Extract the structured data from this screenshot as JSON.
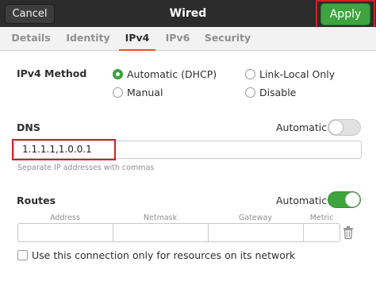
{
  "header": {
    "cancel_label": "Cancel",
    "title": "Wired",
    "apply_label": "Apply"
  },
  "tabs": [
    {
      "label": "Details"
    },
    {
      "label": "Identity"
    },
    {
      "label": "IPv4",
      "active": true
    },
    {
      "label": "IPv6"
    },
    {
      "label": "Security"
    }
  ],
  "ipv4_method": {
    "label": "IPv4 Method",
    "options": [
      {
        "label": "Automatic (DHCP)",
        "selected": true
      },
      {
        "label": "Link-Local Only",
        "selected": false
      },
      {
        "label": "Manual",
        "selected": false
      },
      {
        "label": "Disable",
        "selected": false
      }
    ]
  },
  "dns": {
    "label": "DNS",
    "automatic_label": "Automatic",
    "automatic_on": false,
    "value": "1.1.1.1,1.0.0.1",
    "hint": "Separate IP addresses with commas"
  },
  "routes": {
    "label": "Routes",
    "automatic_label": "Automatic",
    "automatic_on": true,
    "columns": [
      "Address",
      "Netmask",
      "Gateway",
      "Metric"
    ]
  },
  "only_resources_label": "Use this connection only for resources on its network",
  "colors": {
    "accent_green": "#3ea43e",
    "highlight_red": "#d12027",
    "tab_underline": "#e95420",
    "header_bg": "#2c2c2c"
  },
  "icons": {
    "delete_route": "trash-icon"
  }
}
